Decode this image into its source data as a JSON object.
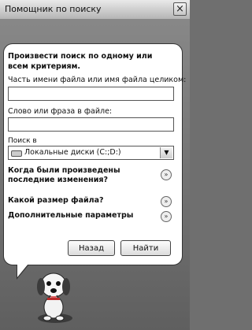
{
  "window": {
    "title": "Помощник по поиску",
    "close_glyph": "×"
  },
  "prompt": "Произвести поиск по одному или всем критериям.",
  "fields": {
    "filename_label": "Часть имени файла или имя файла целиком:",
    "filename_value": "",
    "phrase_label": "Слово или фраза в файле:",
    "phrase_value": "",
    "search_in_label": "Поиск в",
    "search_in_value": "Локальные диски (C:;D:)"
  },
  "sections": [
    {
      "label": "Когда были произведены\nпоследние изменения?",
      "icon": "chevron-double-down-icon"
    },
    {
      "label": "Какой размер файла?",
      "icon": "chevron-double-down-icon"
    },
    {
      "label": "Дополнительные параметры",
      "icon": "chevron-double-down-icon"
    }
  ],
  "buttons": {
    "back": "Назад",
    "search": "Найти"
  },
  "icons": {
    "drive": "drive-icon",
    "assistant": "search-dog-icon"
  }
}
